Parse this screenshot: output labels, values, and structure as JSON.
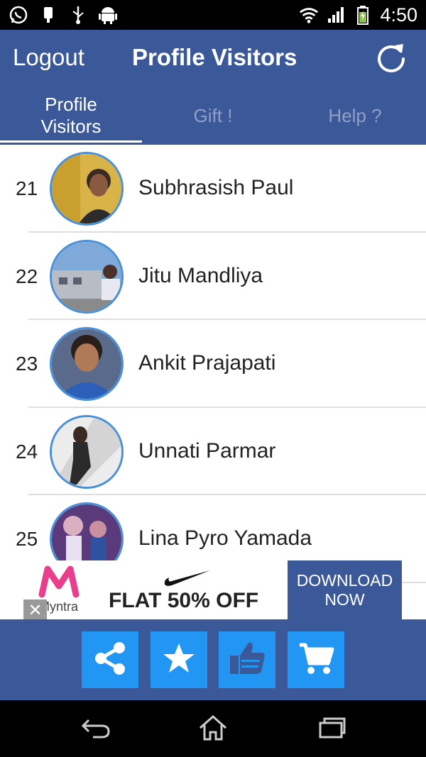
{
  "status_bar": {
    "time": "4:50",
    "left_icons": [
      "whatsapp-icon",
      "phone-plug-icon",
      "usb-icon",
      "android-icon"
    ],
    "right_icons": [
      "wifi-icon",
      "signal-icon",
      "battery-icon"
    ]
  },
  "header": {
    "logout_label": "Logout",
    "title": "Profile Visitors",
    "refresh_icon": "refresh-icon"
  },
  "tabs": [
    {
      "label": "Profile Visitors",
      "active": true
    },
    {
      "label": "Gift !",
      "active": false
    },
    {
      "label": "Help ?",
      "active": false
    }
  ],
  "visitors": [
    {
      "rank": "21",
      "name": "Subhrasish Paul"
    },
    {
      "rank": "22",
      "name": "Jitu Mandliya"
    },
    {
      "rank": "23",
      "name": "Ankit Prajapati"
    },
    {
      "rank": "24",
      "name": "Unnati Parmar"
    },
    {
      "rank": "25",
      "name": "Lina Pyro Yamada"
    }
  ],
  "ad": {
    "brand": "Myntra",
    "offer": "FLAT 50% OFF",
    "cta": "DOWNLOAD NOW",
    "close": "✕"
  },
  "action_bar": [
    "share-icon",
    "star-icon",
    "thumbs-up-icon",
    "cart-icon"
  ],
  "nav_bar": [
    "back-icon",
    "home-icon",
    "recent-apps-icon"
  ],
  "colors": {
    "brand_blue": "#3b5998",
    "action_button": "#2196f3",
    "avatar_border": "#4a8fd8"
  }
}
